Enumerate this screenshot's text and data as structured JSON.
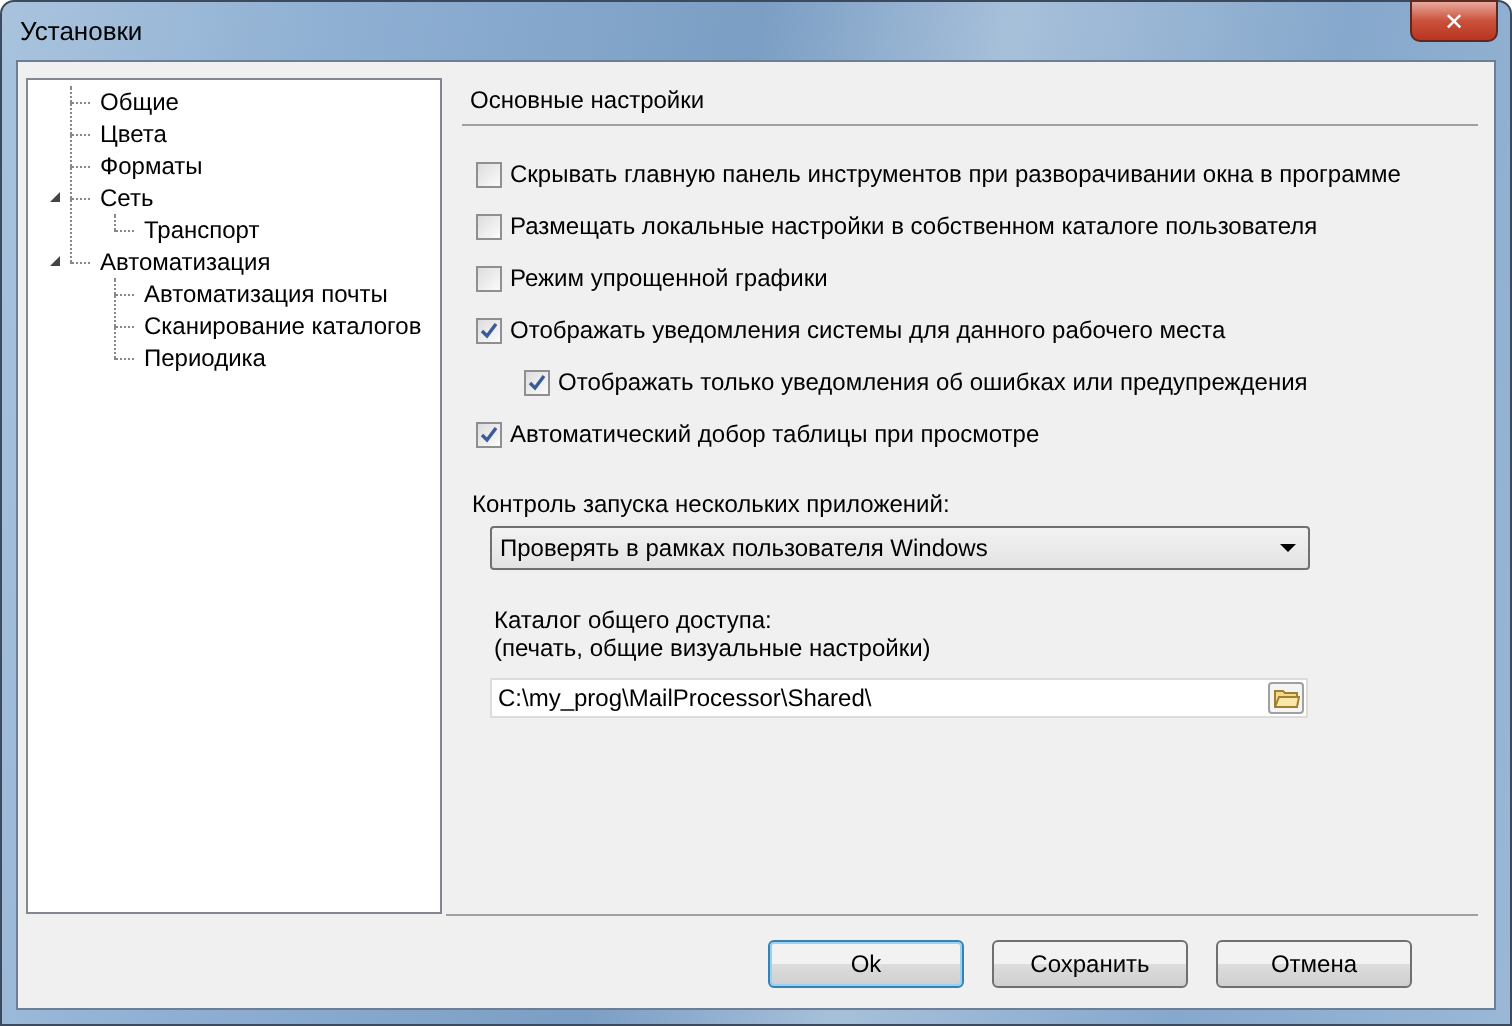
{
  "window": {
    "title": "Установки",
    "close": "✕"
  },
  "tree": [
    {
      "label": "Общие"
    },
    {
      "label": "Цвета"
    },
    {
      "label": "Форматы"
    },
    {
      "label": "Сеть",
      "expanded": true,
      "children": [
        {
          "label": "Транспорт"
        }
      ]
    },
    {
      "label": "Автоматизация",
      "expanded": true,
      "children": [
        {
          "label": "Автоматизация почты"
        },
        {
          "label": "Сканирование каталогов"
        },
        {
          "label": "Периодика"
        }
      ]
    }
  ],
  "section_title": "Основные настройки",
  "options": [
    {
      "label": "Скрывать главную панель инструментов при разворачивании окна в программе",
      "checked": false
    },
    {
      "label": "Размещать локальные настройки в собственном каталоге пользователя",
      "checked": false
    },
    {
      "label": "Режим упрощенной графики",
      "checked": false
    },
    {
      "label": "Отображать уведомления системы для данного рабочего места",
      "checked": true,
      "children": [
        {
          "label": "Отображать только уведомления об ошибках или предупреждения",
          "checked": true
        }
      ]
    },
    {
      "label": "Автоматический добор таблицы при просмотре",
      "checked": true
    }
  ],
  "launch_control": {
    "label": "Контроль запуска нескольких приложений:",
    "value": "Проверять в рамках пользователя Windows"
  },
  "shared_folder": {
    "label": "Каталог общего доступа:",
    "hint": "(печать, общие визуальные настройки)",
    "value": "C:\\my_prog\\MailProcessor\\Shared\\"
  },
  "buttons": [
    {
      "label": "Ok",
      "default": true
    },
    {
      "label": "Сохранить",
      "default": false
    },
    {
      "label": "Отмена",
      "default": false
    }
  ]
}
